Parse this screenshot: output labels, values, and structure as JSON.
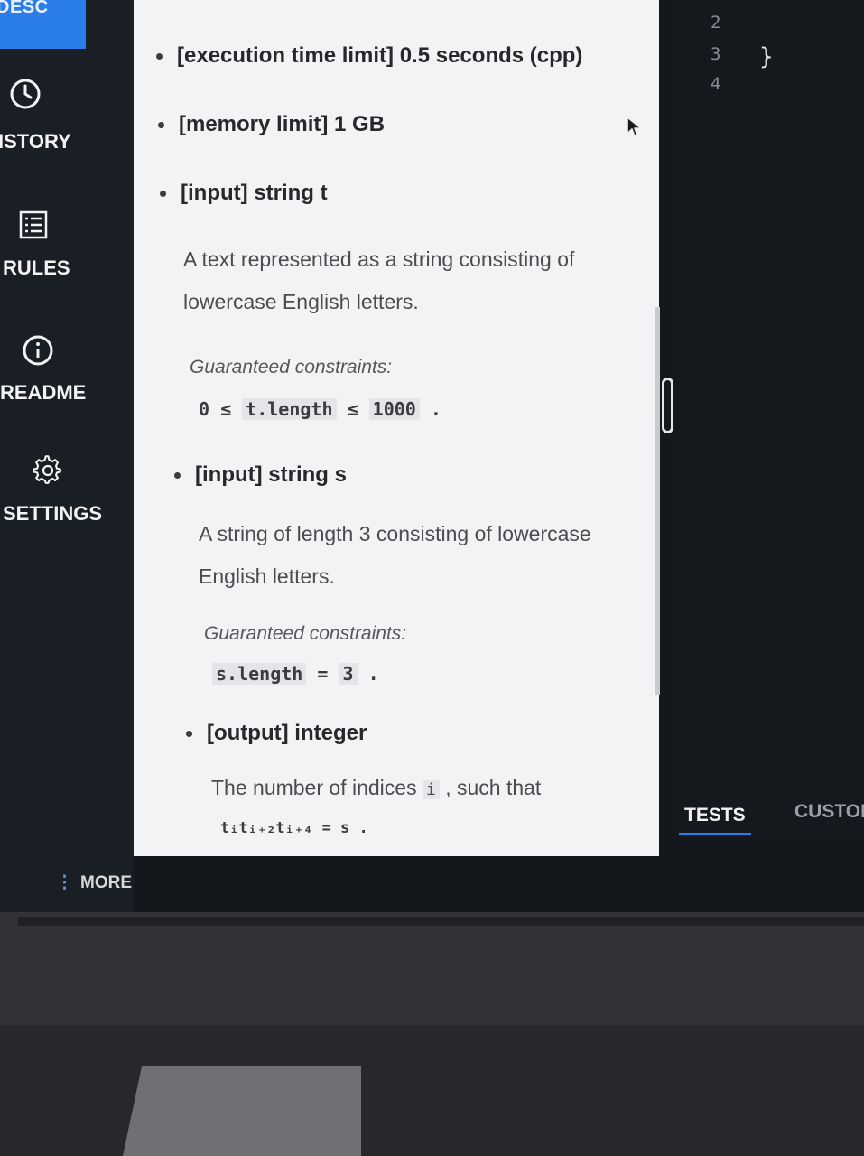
{
  "sidebar": {
    "desc_tab": "DESC",
    "items": [
      {
        "label": "ISTORY",
        "icon": "clock-icon"
      },
      {
        "label": "RULES",
        "icon": "list-icon"
      },
      {
        "label": "README",
        "icon": "info-icon"
      },
      {
        "label": "SETTINGS",
        "icon": "gear-icon"
      }
    ],
    "more_dots": "⋮",
    "more_label": "MORE"
  },
  "description": {
    "time_limit": "[execution time limit] 0.5 seconds (cpp)",
    "memory_limit": "[memory limit] 1 GB",
    "input_t_label": "[input] string t",
    "input_t_desc_1": "A text represented as a string consisting of",
    "input_t_desc_2": "lowercase English letters.",
    "guaranteed_1": "Guaranteed constraints:",
    "constraint_t": {
      "a": "0",
      "le1": "≤",
      "var": "t.length",
      "le2": "≤",
      "b": "1000",
      "end": "."
    },
    "input_s_label": "[input] string s",
    "input_s_desc_1": "A string of length 3 consisting of lowercase",
    "input_s_desc_2": "English letters.",
    "guaranteed_2": "Guaranteed constraints:",
    "constraint_s": {
      "var": "s.length",
      "eq": "=",
      "val": "3",
      "end": "."
    },
    "output_label": "[output] integer",
    "output_desc_1": "The number of indices",
    "output_desc_var": "i",
    "output_desc_2": ", such that",
    "output_formula": "tᵢtᵢ₊₂tᵢ₊₄ = s ."
  },
  "editor": {
    "line_numbers": [
      "2",
      "3",
      "4"
    ],
    "brace": "}"
  },
  "bottom_tabs": {
    "tests": "TESTS",
    "custom": "CUSTOI"
  },
  "colors": {
    "accent": "#2b7de9",
    "sidebar_bg": "#1a1e25",
    "panel_bg": "#f2f3f5",
    "editor_bg": "#15181d"
  }
}
